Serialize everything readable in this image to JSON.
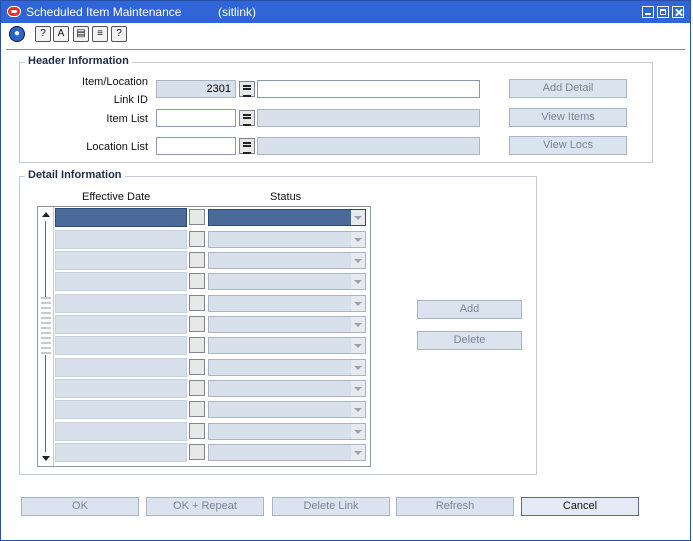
{
  "window": {
    "title": "Scheduled Item Maintenance",
    "subtitle": "(sitlink)"
  },
  "header": {
    "title": "Header Information",
    "item_location_label": "Item/Location",
    "link_id_label": "Link ID",
    "link_id_value": "2301",
    "link_desc_value": "",
    "item_list_label": "Item List",
    "item_list_value": "",
    "location_list_label": "Location List",
    "location_list_value": "",
    "add_detail": "Add Detail",
    "view_items": "View Items",
    "view_locs": "View Locs"
  },
  "detail": {
    "title": "Detail Information",
    "col_effective_date": "Effective Date",
    "col_status": "Status",
    "rows": [
      {
        "date": "",
        "status": "",
        "selected": true
      },
      {
        "date": "",
        "status": ""
      },
      {
        "date": "",
        "status": ""
      },
      {
        "date": "",
        "status": ""
      },
      {
        "date": "",
        "status": ""
      },
      {
        "date": "",
        "status": ""
      },
      {
        "date": "",
        "status": ""
      },
      {
        "date": "",
        "status": ""
      },
      {
        "date": "",
        "status": ""
      },
      {
        "date": "",
        "status": ""
      },
      {
        "date": "",
        "status": ""
      },
      {
        "date": "",
        "status": ""
      }
    ],
    "add": "Add",
    "delete": "Delete"
  },
  "footer": {
    "ok": "OK",
    "ok_repeat": "OK + Repeat",
    "delete_link": "Delete Link",
    "refresh": "Refresh",
    "cancel": "Cancel"
  }
}
